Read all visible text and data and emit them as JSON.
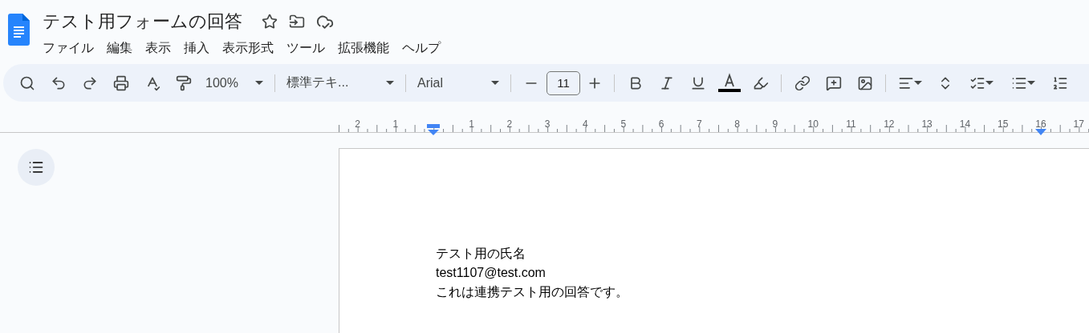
{
  "document": {
    "title": "テスト用フォームの回答"
  },
  "menu": [
    "ファイル",
    "編集",
    "表示",
    "挿入",
    "表示形式",
    "ツール",
    "拡張機能",
    "ヘルプ"
  ],
  "toolbar": {
    "zoom": "100%",
    "style": "標準テキ...",
    "font": "Arial",
    "font_size": "11"
  },
  "ruler": {
    "left_labels": [
      "2",
      "1"
    ],
    "right_labels": [
      "1",
      "2",
      "3",
      "4",
      "5",
      "6",
      "7",
      "8",
      "9",
      "10",
      "11",
      "12",
      "13",
      "14",
      "15",
      "16",
      "17"
    ]
  },
  "page": {
    "lines": [
      "テスト用の氏名",
      "test1107@test.com",
      "これは連携テスト用の回答です。"
    ]
  }
}
